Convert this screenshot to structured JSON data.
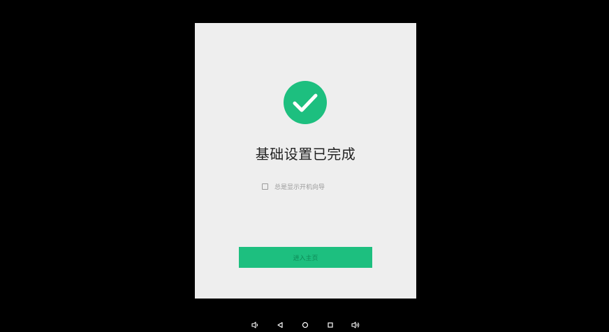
{
  "dialog": {
    "title": "基础设置已完成",
    "checkbox_label": "总是显示开机向导",
    "checkbox_checked": false,
    "primary_button_label": "进入主页",
    "status_icon": "checkmark-circle-icon"
  },
  "navbar": {
    "icons": [
      "volume-down-icon",
      "back-icon",
      "home-icon",
      "recents-icon",
      "volume-up-icon"
    ]
  },
  "colors": {
    "accent": "#1dbf7f",
    "dialog_background": "#eeeeee",
    "screen_background": "#000000"
  }
}
